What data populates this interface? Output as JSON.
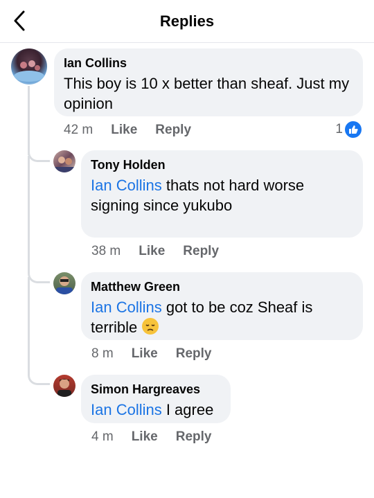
{
  "header": {
    "title": "Replies"
  },
  "comments": [
    {
      "author": "Ian Collins",
      "mention": "",
      "text": "This boy is 10 x better than sheaf. Just my opinion",
      "time": "42 m",
      "like_label": "Like",
      "reply_label": "Reply",
      "reaction_count": "1"
    },
    {
      "author": "Tony Holden",
      "mention": "Ian Collins",
      "text": " thats not hard worse signing since yukubo",
      "time": "38 m",
      "like_label": "Like",
      "reply_label": "Reply"
    },
    {
      "author": "Matthew Green",
      "mention": "Ian Collins",
      "text": " got to be coz Sheaf is terrible ",
      "time": "8 m",
      "like_label": "Like",
      "reply_label": "Reply",
      "emoji": "disappointed-face-emoji"
    },
    {
      "author": "Simon Hargreaves",
      "mention": "Ian Collins",
      "text": " I agree",
      "time": "4 m",
      "like_label": "Like",
      "reply_label": "Reply"
    }
  ],
  "colors": {
    "mention": "#1b74e4",
    "like_badge": "#1877f2",
    "bubble": "#f0f2f5"
  }
}
